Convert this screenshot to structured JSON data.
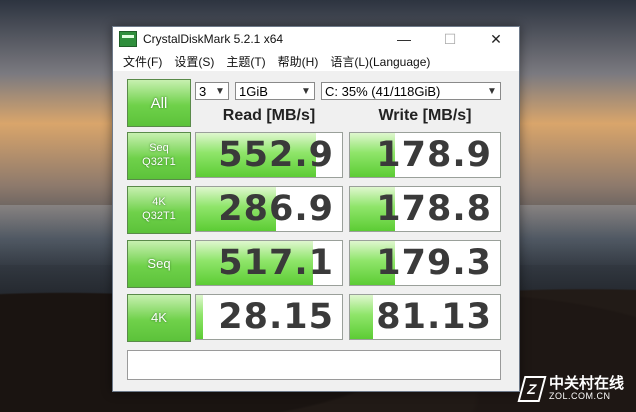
{
  "window": {
    "title": "CrystalDiskMark 5.2.1 x64",
    "minimize": "—",
    "maximize": "☐",
    "close": "✕"
  },
  "menu": [
    "文件(F)",
    "设置(S)",
    "主题(T)",
    "帮助(H)",
    "语言(L)(Language)"
  ],
  "controls": {
    "all_label": "All",
    "count": "3",
    "size": "1GiB",
    "drive": "C: 35% (41/118GiB)"
  },
  "headers": {
    "read": "Read [MB/s]",
    "write": "Write [MB/s]"
  },
  "rows": [
    {
      "label1": "Seq",
      "label2": "Q32T1",
      "read": "552.9",
      "write": "178.9",
      "read_fill": 0.82,
      "write_fill": 0.3
    },
    {
      "label1": "4K",
      "label2": "Q32T1",
      "read": "286.9",
      "write": "178.8",
      "read_fill": 0.55,
      "write_fill": 0.3
    },
    {
      "label1": "Seq",
      "label2": "",
      "read": "517.1",
      "write": "179.3",
      "read_fill": 0.8,
      "write_fill": 0.3
    },
    {
      "label1": "4K",
      "label2": "",
      "read": "28.15",
      "write": "81.13",
      "read_fill": 0.05,
      "write_fill": 0.15
    }
  ],
  "comment": "",
  "watermark": {
    "cn": "中关村在线",
    "en": "ZOL.COM.CN",
    "mark": "Z"
  },
  "colors": {
    "accent_green": "#6fd14a",
    "bar_green": "#5ccc34"
  }
}
